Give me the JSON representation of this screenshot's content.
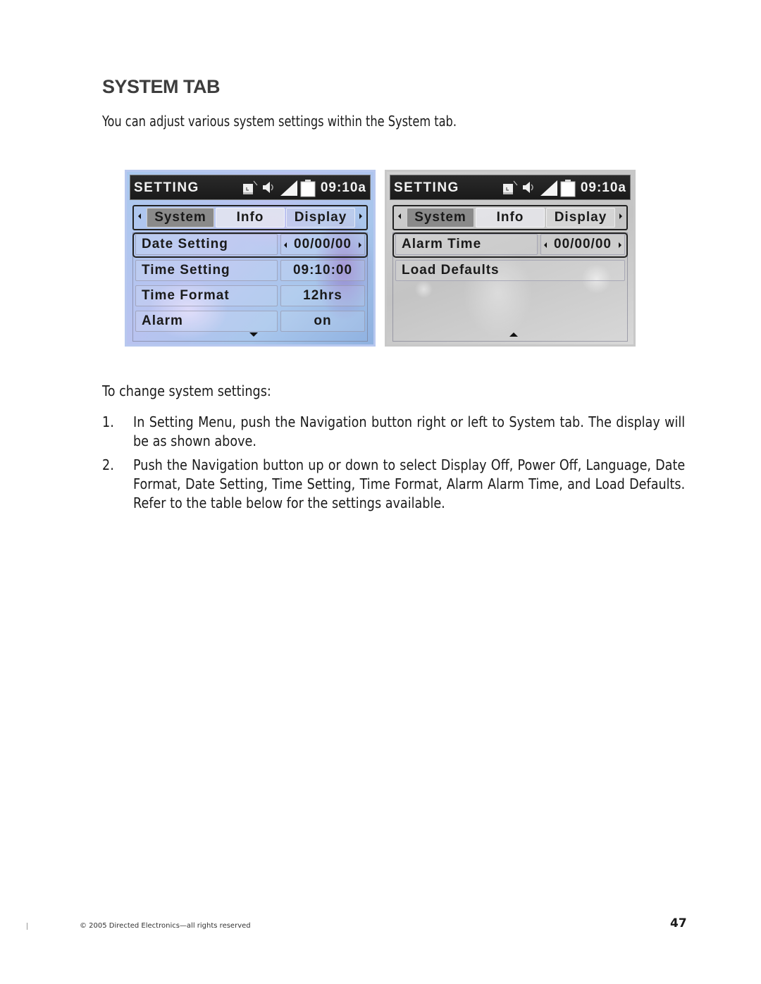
{
  "heading": "SYSTEM TAB",
  "intro": "You can adjust various system settings within the System tab.",
  "screens": [
    {
      "title": "SETTING",
      "time": "09:10a",
      "status_icons": [
        "alarm-clock-icon",
        "speaker-icon",
        "volume-level-icon",
        "battery-icon"
      ],
      "tabs": [
        "System",
        "Info",
        "Display"
      ],
      "active_tab": "System",
      "rows": [
        {
          "label": "Date Setting",
          "value": "00/00/00",
          "selected": true,
          "arrows": true
        },
        {
          "label": "Time Setting",
          "value": "09:10:00"
        },
        {
          "label": "Time Format",
          "value": "12hrs"
        },
        {
          "label": "Alarm",
          "value": "on"
        }
      ],
      "scroll_indicator": "down"
    },
    {
      "title": "SETTING",
      "time": "09:10a",
      "status_icons": [
        "alarm-clock-icon",
        "speaker-icon",
        "volume-level-icon",
        "battery-icon"
      ],
      "tabs": [
        "System",
        "Info",
        "Display"
      ],
      "active_tab": "System",
      "rows": [
        {
          "label": "Alarm Time",
          "value": "00/00/00",
          "selected": true,
          "arrows": true
        },
        {
          "label": "Load Defaults"
        }
      ],
      "scroll_indicator": "up"
    }
  ],
  "instructions_intro": "To change system settings:",
  "steps": [
    {
      "num": "1.",
      "text": "In Setting Menu, push the Navigation button right or left to System tab. The display will be as shown above."
    },
    {
      "num": "2.",
      "text": "Push the Navigation button up or down to select Display Off, Power Off, Language, Date Format, Date Setting, Time Setting, Time Format, Alarm Alarm Time, and Load Defaults. Refer to the table below for the settings available."
    }
  ],
  "footer": {
    "copyright": "© 2005  Directed Electronics—all rights reserved",
    "page_number": "47"
  }
}
